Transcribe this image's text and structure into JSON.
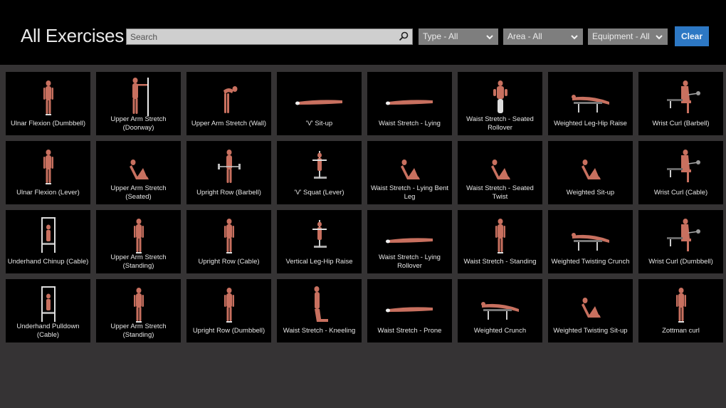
{
  "header": {
    "title": "All Exercises",
    "search": {
      "placeholder": "Search",
      "value": ""
    },
    "filters": [
      {
        "label": "Type - All"
      },
      {
        "label": "Area - All"
      },
      {
        "label": "Equipment - All"
      }
    ],
    "clear_label": "Clear"
  },
  "colors": {
    "header_bg": "#000000",
    "page_bg": "#353334",
    "tile_bg": "#000000",
    "dropdown_bg": "#7e7e7e",
    "accent": "#2d78c4",
    "muscle": "#c8705f"
  },
  "exercises": [
    {
      "name": "Ulnar Flexion (Dumbbell)",
      "pose": "standing"
    },
    {
      "name": "Upper Arm Stretch (Doorway)",
      "pose": "wall"
    },
    {
      "name": "Upper Arm Stretch (Wall)",
      "pose": "bent"
    },
    {
      "name": "'V' Sit-up",
      "pose": "lying"
    },
    {
      "name": "Waist Stretch - Lying",
      "pose": "lying"
    },
    {
      "name": "Waist Stretch - Seated Rollover",
      "pose": "seated-front"
    },
    {
      "name": "Weighted Leg-Hip Raise",
      "pose": "bench-lying"
    },
    {
      "name": "Wrist Curl (Barbell)",
      "pose": "bench-seated"
    },
    {
      "name": "Ulnar Flexion (Lever)",
      "pose": "standing"
    },
    {
      "name": "Upper Arm Stretch (Seated)",
      "pose": "seated-floor"
    },
    {
      "name": "Upright Row (Barbell)",
      "pose": "standing-bar"
    },
    {
      "name": "'V' Squat (Lever)",
      "pose": "machine"
    },
    {
      "name": "Waist Stretch - Lying Bent Leg",
      "pose": "seated-floor"
    },
    {
      "name": "Waist Stretch - Seated Twist",
      "pose": "seated-floor"
    },
    {
      "name": "Weighted Sit-up",
      "pose": "seated-floor"
    },
    {
      "name": "Wrist Curl (Cable)",
      "pose": "bench-seated"
    },
    {
      "name": "Underhand Chinup (Cable)",
      "pose": "frame"
    },
    {
      "name": "Upper Arm Stretch (Standing)",
      "pose": "standing"
    },
    {
      "name": "Upright Row (Cable)",
      "pose": "standing"
    },
    {
      "name": "Vertical Leg-Hip Raise",
      "pose": "machine"
    },
    {
      "name": "Waist Stretch - Lying Rollover",
      "pose": "lying"
    },
    {
      "name": "Waist Stretch - Standing",
      "pose": "standing"
    },
    {
      "name": "Weighted Twisting Crunch",
      "pose": "bench-lying"
    },
    {
      "name": "Wrist Curl (Dumbbell)",
      "pose": "bench-seated"
    },
    {
      "name": "Underhand Pulldown (Cable)",
      "pose": "frame"
    },
    {
      "name": "Upper Arm Stretch (Standing)",
      "pose": "standing"
    },
    {
      "name": "Upright Row (Dumbbell)",
      "pose": "standing"
    },
    {
      "name": "Waist Stretch - Kneeling",
      "pose": "kneeling"
    },
    {
      "name": "Waist Stretch - Prone",
      "pose": "lying"
    },
    {
      "name": "Weighted Crunch",
      "pose": "bench-lying"
    },
    {
      "name": "Weighted Twisting Sit-up",
      "pose": "seated-floor"
    },
    {
      "name": "Zottman curl",
      "pose": "standing"
    }
  ]
}
